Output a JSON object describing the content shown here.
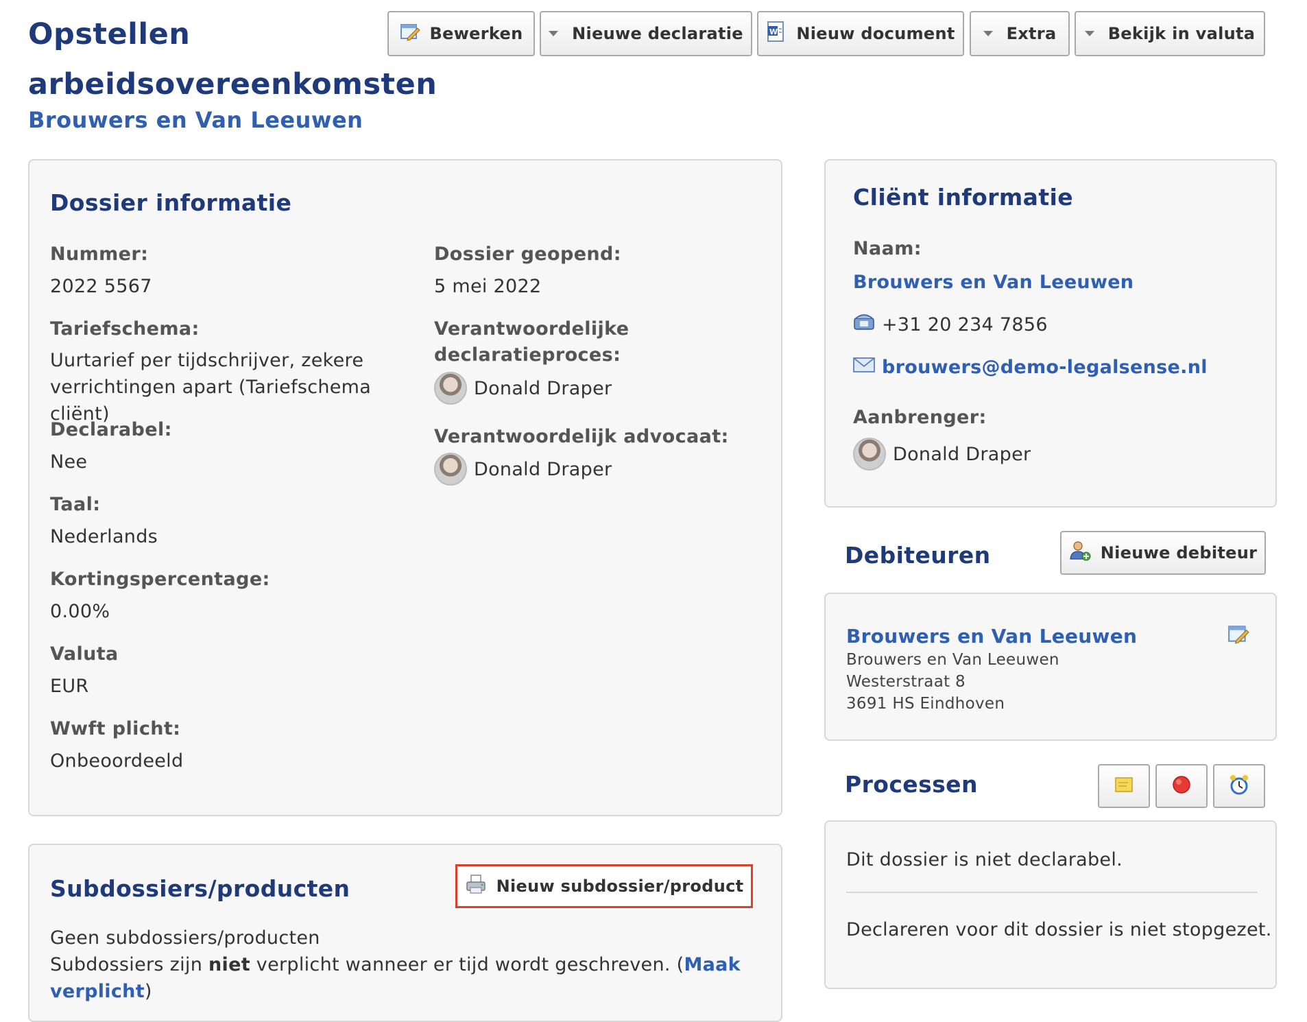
{
  "page": {
    "title": "Opstellen arbeidsovereenkomsten",
    "subtitle": "Brouwers en Van Leeuwen"
  },
  "toolbar": {
    "edit_label": "Bewerken",
    "new_invoice_label": "Nieuwe declaratie",
    "new_document_label": "Nieuw document",
    "extra_label": "Extra",
    "currency_label": "Bekijk in valuta"
  },
  "dossier": {
    "heading": "Dossier informatie",
    "number_label": "Nummer:",
    "number_value": "2022 5567",
    "opened_label": "Dossier geopend:",
    "opened_value": "5 mei 2022",
    "tariff_label": "Tariefschema:",
    "tariff_value": "Uurtarief per tijdschrijver, zekere verrichtingen apart (Tariefschema cliënt)",
    "responsible_invoicing_label": "Verantwoordelijke declaratieproces:",
    "responsible_invoicing_name": "Donald Draper",
    "billable_label": "Declarabel:",
    "billable_value": "Nee",
    "responsible_lawyer_label": "Verantwoordelijk advocaat:",
    "responsible_lawyer_name": "Donald Draper",
    "language_label": "Taal:",
    "language_value": "Nederlands",
    "discount_label": "Kortingspercentage:",
    "discount_value": "0.00%",
    "currency_label": "Valuta",
    "currency_value": "EUR",
    "wwft_label": "Wwft plicht:",
    "wwft_value": "Onbeoordeeld"
  },
  "subdossiers": {
    "heading": "Subdossiers/producten",
    "new_button_label": "Nieuw subdossier/product",
    "empty_text": "Geen subdossiers/producten",
    "note_prefix": "Subdossiers zijn ",
    "note_bold": "niet",
    "note_middle": " verplicht wanneer er tijd wordt geschreven. (",
    "note_link": "Maak verplicht",
    "note_suffix": ")"
  },
  "client": {
    "heading": "Cliënt informatie",
    "name_label": "Naam:",
    "name_value": "Brouwers en Van Leeuwen",
    "phone": "+31 20 234 7856",
    "email": "brouwers@demo-legalsense.nl",
    "introducer_label": "Aanbrenger:",
    "introducer_name": "Donald Draper"
  },
  "debtors": {
    "heading": "Debiteuren",
    "new_button_label": "Nieuwe debiteur",
    "items": [
      {
        "name": "Brouwers en Van Leeuwen",
        "line1": "Brouwers en Van Leeuwen",
        "line2": "Westerstraat 8",
        "line3": "3691 HS Eindhoven"
      }
    ]
  },
  "processes": {
    "heading": "Processen",
    "status1": "Dit dossier is niet declarabel.",
    "status2": "Declareren voor dit dossier is niet stopgezet."
  },
  "colors": {
    "heading": "#1f3a7a",
    "link": "#2f5fb3",
    "highlight": "#d9412b"
  }
}
